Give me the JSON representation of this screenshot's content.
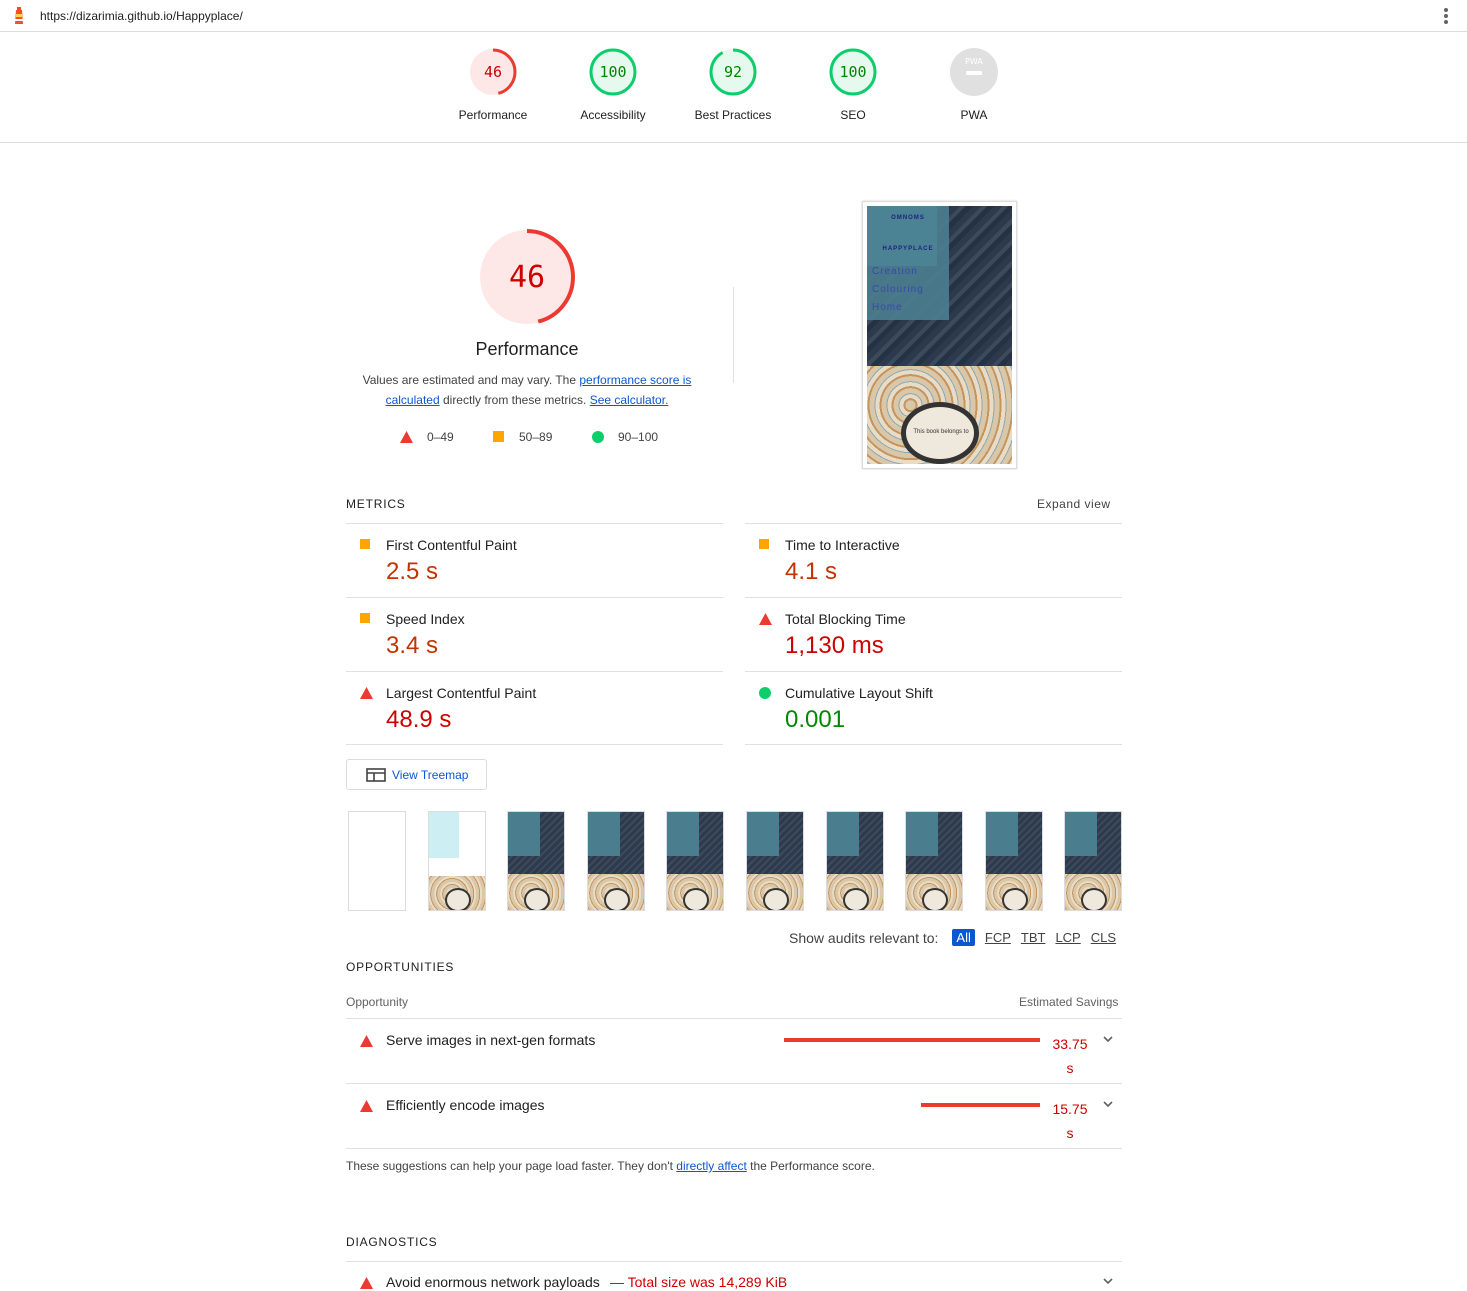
{
  "url": "https://dizarimia.github.io/Happyplace/",
  "colors": {
    "fail": "#eb3a32",
    "average": "#ffa400",
    "pass": "#0cce6b",
    "link": "#0b57d0"
  },
  "gauges": [
    {
      "score": "46",
      "label": "Performance",
      "fraction": 0.46,
      "status": "fail"
    },
    {
      "score": "100",
      "label": "Accessibility",
      "fraction": 1.0,
      "status": "pass"
    },
    {
      "score": "92",
      "label": "Best Practices",
      "fraction": 0.92,
      "status": "pass"
    },
    {
      "score": "100",
      "label": "SEO",
      "fraction": 1.0,
      "status": "pass"
    },
    {
      "score": "PWA",
      "label": "PWA",
      "status": "na"
    }
  ],
  "summary": {
    "score": "46",
    "title": "Performance",
    "desc_prefix": "Values are estimated and may vary. The ",
    "desc_link1": "performance score is calculated",
    "desc_mid": " directly from these metrics. ",
    "desc_link2": "See calculator.",
    "legend": [
      "0–49",
      "50–89",
      "90–100"
    ]
  },
  "screenshot": {
    "nav": [
      "OMNOMS",
      "HAPPYPLACE",
      "Creation",
      "Colouring",
      "Home"
    ],
    "book_text": "This book belongs to"
  },
  "metrics": {
    "title": "METRICS",
    "expand": "Expand view",
    "items": [
      {
        "label": "First Contentful Paint",
        "value": "2.5 s",
        "status": "average"
      },
      {
        "label": "Time to Interactive",
        "value": "4.1 s",
        "status": "average"
      },
      {
        "label": "Speed Index",
        "value": "3.4 s",
        "status": "average"
      },
      {
        "label": "Total Blocking Time",
        "value": "1,130 ms",
        "status": "fail"
      },
      {
        "label": "Largest Contentful Paint",
        "value": "48.9 s",
        "status": "fail"
      },
      {
        "label": "Cumulative Layout Shift",
        "value": "0.001",
        "status": "pass"
      }
    ]
  },
  "treemap_label": "View Treemap",
  "filter": {
    "label": "Show audits relevant to:",
    "chips": [
      "All",
      "FCP",
      "TBT",
      "LCP",
      "CLS"
    ]
  },
  "opportunities": {
    "title": "OPPORTUNITIES",
    "col_left": "Opportunity",
    "col_right": "Estimated Savings",
    "items": [
      {
        "label": "Serve images in next-gen formats",
        "savings_num": "33.75",
        "savings_unit": "s",
        "seconds": 33.75
      },
      {
        "label": "Efficiently encode images",
        "savings_num": "15.75",
        "savings_unit": "s",
        "seconds": 15.75
      }
    ],
    "note_prefix": "These suggestions can help your page load faster. They don't ",
    "note_link": "directly affect",
    "note_suffix": " the Performance score."
  },
  "diagnostics": {
    "title": "DIAGNOSTICS",
    "items": [
      {
        "label": "Avoid enormous network payloads",
        "detail": "— Total size was 14,289 KiB"
      }
    ]
  }
}
